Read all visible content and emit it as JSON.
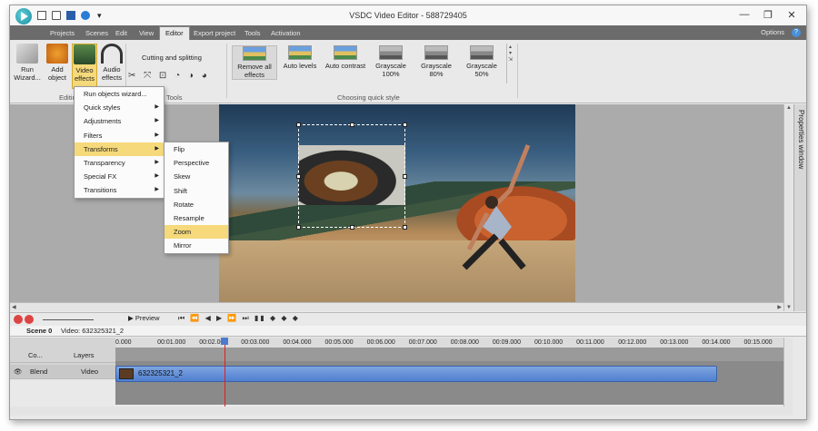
{
  "window": {
    "title": "VSDC Video Editor - 588729405",
    "minimize": "—",
    "restore": "❐",
    "close": "✕"
  },
  "quick_access": {
    "more": "▾"
  },
  "tabs": [
    "Projects",
    "Scenes",
    "Edit",
    "View",
    "Editor",
    "Export project",
    "Tools",
    "Activation"
  ],
  "active_tab": "Editor",
  "options": {
    "label": "Options",
    "caret": "⌃ ⚙",
    "help": "?"
  },
  "ribbon": {
    "run_wizard": "Run Wizard...",
    "add_object": "Add object",
    "video_effects": "Video effects",
    "audio_effects": "Audio effects",
    "editing_group": "Editing",
    "tools_group": "Tools",
    "cutting_splitting": "Cutting and splitting",
    "quick_styles_group": "Choosing quick style",
    "quick_styles": [
      {
        "label": "Remove all effects"
      },
      {
        "label": "Auto levels"
      },
      {
        "label": "Auto contrast"
      },
      {
        "label": "Grayscale 100%"
      },
      {
        "label": "Grayscale 80%"
      },
      {
        "label": "Grayscale 50%"
      }
    ]
  },
  "effects_menu": {
    "items": [
      {
        "label": "Run objects wizard...",
        "submenu": false
      },
      {
        "label": "Quick styles",
        "submenu": true
      },
      {
        "label": "Adjustments",
        "submenu": true
      },
      {
        "label": "Filters",
        "submenu": true
      },
      {
        "label": "Transforms",
        "submenu": true
      },
      {
        "label": "Transparency",
        "submenu": true
      },
      {
        "label": "Special FX",
        "submenu": true
      },
      {
        "label": "Transitions",
        "submenu": true
      }
    ],
    "highlighted": "Transforms"
  },
  "transforms_menu": {
    "items": [
      "Flip",
      "Perspective",
      "Skew",
      "Shift",
      "Rotate",
      "Resample",
      "Zoom",
      "Mirror"
    ],
    "highlighted": "Zoom"
  },
  "properties_window": {
    "label": "Properties window"
  },
  "timeline": {
    "preview_label": "Preview",
    "scene_tab": "Scene 0",
    "video_tab": "Video: 632325321_2",
    "col_label": "Co...",
    "layers_label": "Layers",
    "blend_label": "Blend",
    "video_label": "Video",
    "clip_label": "632325321_2",
    "ruler": [
      "0.000",
      "00:01.000",
      "00:02.000",
      "00:03.000",
      "00:04.000",
      "00:05.000",
      "00:06.000",
      "00:07.000",
      "00:08.000",
      "00:09.000",
      "00:10.000",
      "00:11.000",
      "00:12.000",
      "00:13.000",
      "00:14.000",
      "00:15.000"
    ]
  }
}
